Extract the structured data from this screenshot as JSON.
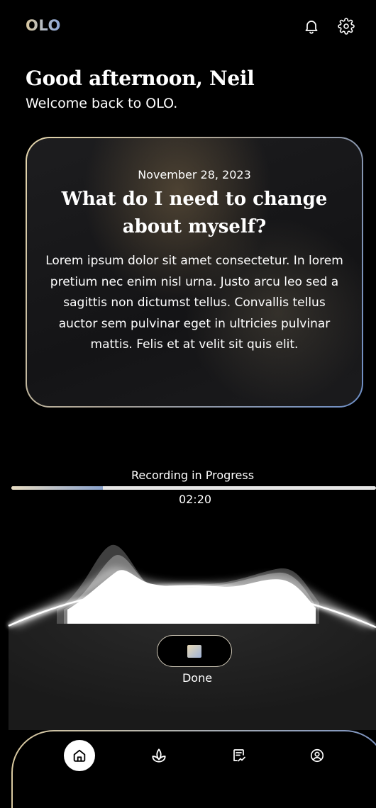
{
  "header": {
    "logo": "OLO",
    "notifications_icon": "bell-icon",
    "settings_icon": "gear-icon"
  },
  "greeting": {
    "title": "Good afternoon, Neil",
    "subtitle": "Welcome back to OLO."
  },
  "prompt_card": {
    "date": "November 28, 2023",
    "question": "What do I need to change about myself?",
    "body": "Lorem ipsum dolor sit amet consectetur. In lorem pretium nec enim nisl urna. Justo arcu leo sed a sagittis non dictumst tellus. Convallis tellus auctor sem pulvinar eget in ultricies pulvinar mattis. Felis et at velit sit quis elit."
  },
  "recording": {
    "status": "Recording in Progress",
    "elapsed": "02:20",
    "progress": 0.25,
    "done_label": "Done",
    "done_icon": "stop-square-icon"
  },
  "bottom_nav": {
    "items": [
      {
        "icon": "home-icon",
        "active": true
      },
      {
        "icon": "plant-icon",
        "active": false
      },
      {
        "icon": "journal-icon",
        "active": false
      },
      {
        "icon": "profile-icon",
        "active": false
      }
    ]
  },
  "colors": {
    "background": "#000000",
    "accent_gold": "#e6d7ad",
    "accent_blue": "#6e8fc7"
  }
}
